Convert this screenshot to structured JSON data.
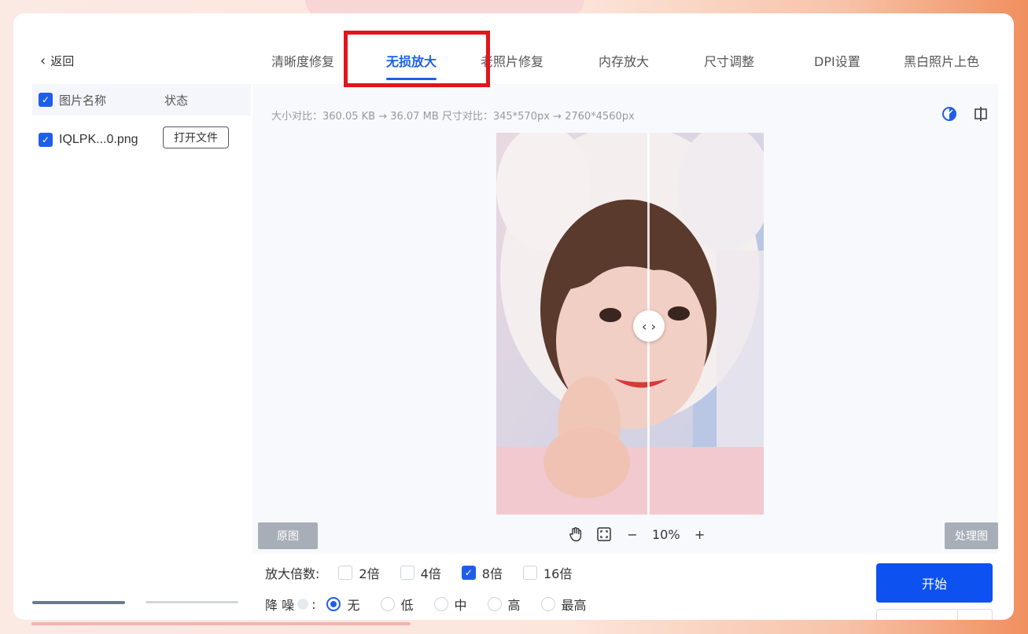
{
  "left_panel": {
    "back_label": "返回",
    "list_header": {
      "name_col": "图片名称",
      "status_col": "状态"
    },
    "files": [
      {
        "name": "IQLPK...0.png",
        "action": "打开文件",
        "checked": true
      }
    ]
  },
  "tabs": [
    "清晰度修复",
    "无损放大",
    "老照片修复",
    "内存放大",
    "尺寸调整",
    "DPI设置",
    "黑白照片上色"
  ],
  "active_tab": "无损放大",
  "info_text": "大小对比：360.05 KB → 36.07 MB   尺寸对比：345*570px → 2760*4560px",
  "preview": {
    "original_label": "原图",
    "processed_label": "处理图",
    "zoom_level": "10%",
    "zoom_minus": "−",
    "zoom_plus": "+",
    "handle_glyph": "‹ ›"
  },
  "controls": {
    "scale_label": "放大倍数:",
    "scale_options": [
      "2倍",
      "4倍",
      "8倍",
      "16倍"
    ],
    "scale_selected": "8倍",
    "noise_label": "降 噪",
    "noise_colon": ":",
    "noise_options": [
      "无",
      "低",
      "中",
      "高",
      "最高"
    ],
    "noise_selected": "无",
    "start_label": "开始"
  },
  "colors": {
    "accent": "#1f5ee8",
    "start_button": "#0d52f0",
    "highlight": "#e3141b"
  }
}
